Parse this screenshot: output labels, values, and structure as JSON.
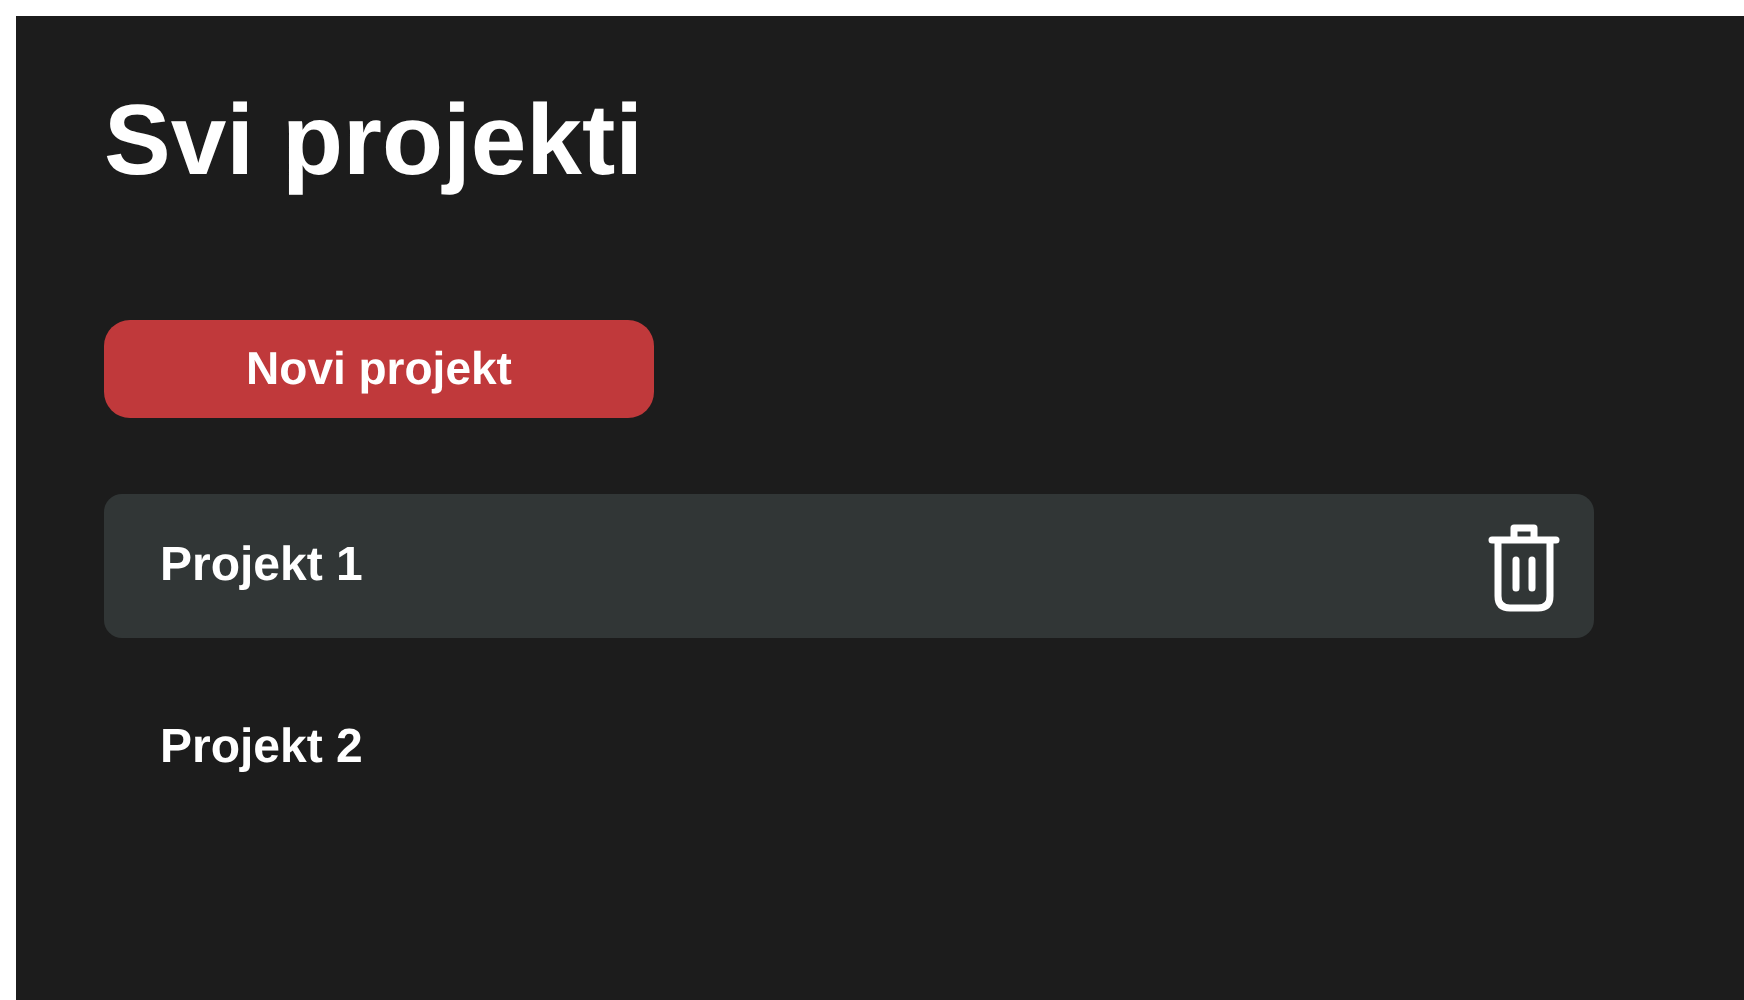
{
  "title": "Svi projekti",
  "new_button": "Novi projekt",
  "projects": [
    {
      "name": "Projekt 1",
      "selected": true
    },
    {
      "name": "Projekt 2",
      "selected": false
    }
  ]
}
